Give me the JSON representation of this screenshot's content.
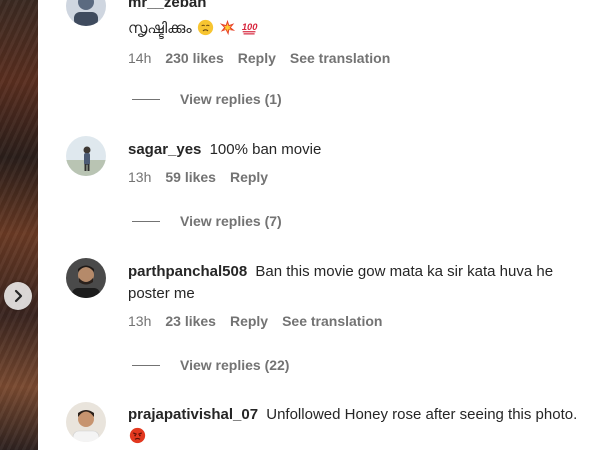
{
  "comments": [
    {
      "username": "mr__zebah",
      "text_line1": "",
      "text_line2": "സൃഷ്ടിക്കും",
      "emojis": [
        "disappointed-face-emoji",
        "collision-emoji",
        "hundred-points-emoji"
      ],
      "time": "14h",
      "likes": "230 likes",
      "reply": "Reply",
      "translate": "See translation",
      "view_replies": "View replies (1)"
    },
    {
      "username": "sagar_yes",
      "text": "100% ban movie",
      "time": "13h",
      "likes": "59 likes",
      "reply": "Reply",
      "view_replies": "View replies (7)"
    },
    {
      "username": "parthpanchal508",
      "text": "Ban this movie gow mata ka sir kata huva he poster me",
      "time": "13h",
      "likes": "23 likes",
      "reply": "Reply",
      "translate": "See translation",
      "view_replies": "View replies (22)"
    },
    {
      "username": "prajapativishal_07",
      "text": "Unfollowed Honey rose after seeing this photo.",
      "emojis": [
        "angry-face-emoji"
      ]
    }
  ],
  "colors": {
    "text": "#262626",
    "muted": "#737373",
    "background": "#ffffff"
  }
}
